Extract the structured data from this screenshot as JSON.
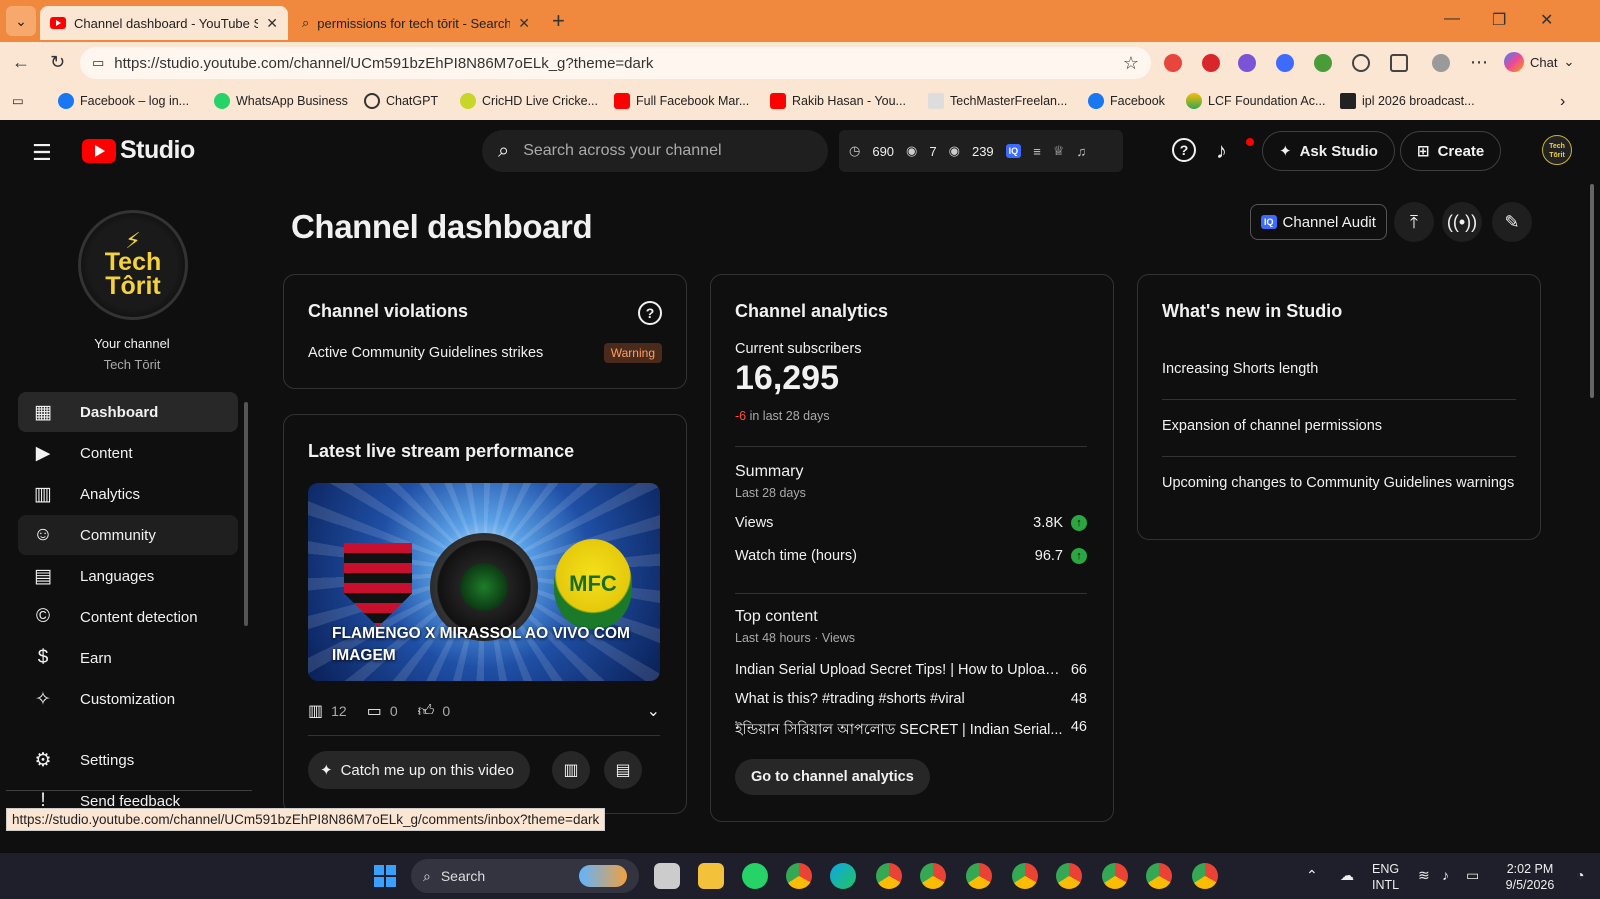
{
  "browser": {
    "tabs": [
      {
        "title": "Channel dashboard - YouTube Stu",
        "active": true
      },
      {
        "title": "permissions for tech tōrit - Search",
        "active": false
      }
    ],
    "url": "https://studio.youtube.com/channel/UCm591bzEhPI8N86M7oELk_g?theme=dark",
    "chat_label": "Chat",
    "bookmarks": [
      "Facebook – log in...",
      "WhatsApp Business",
      "ChatGPT",
      "CricHD Live Cricke...",
      "Full Facebook Mar...",
      "Rakib Hasan - You...",
      "TechMasterFreelan...",
      "Facebook",
      "LCF Foundation Ac...",
      "ipl 2026 broadcast..."
    ],
    "status_url": "https://studio.youtube.com/channel/UCm591bzEhPI8N86M7oELk_g/comments/inbox?theme=dark"
  },
  "header": {
    "logo_text": "Studio",
    "search_placeholder": "Search across your channel",
    "ext_stats": {
      "a": "690",
      "b": "7",
      "c": "239"
    },
    "ask_studio": "Ask Studio",
    "create": "Create",
    "avatar_text": "Tech Tōrit"
  },
  "sidebar": {
    "avatar_line1": "Tech",
    "avatar_line2": "Tôrit",
    "your_channel": "Your channel",
    "channel_name": "Tech Tōrit",
    "items": [
      {
        "label": "Dashboard",
        "icon": "dashboard-icon"
      },
      {
        "label": "Content",
        "icon": "content-icon"
      },
      {
        "label": "Analytics",
        "icon": "analytics-icon"
      },
      {
        "label": "Community",
        "icon": "community-icon"
      },
      {
        "label": "Languages",
        "icon": "subtitles-icon"
      },
      {
        "label": "Content detection",
        "icon": "copyright-icon"
      },
      {
        "label": "Earn",
        "icon": "dollar-icon"
      },
      {
        "label": "Customization",
        "icon": "magic-wand-icon"
      }
    ],
    "settings": "Settings",
    "feedback": "Send feedback"
  },
  "main": {
    "title": "Channel dashboard",
    "channel_audit": "Channel Audit",
    "violations": {
      "title": "Channel violations",
      "row": "Active Community Guidelines strikes",
      "badge": "Warning"
    },
    "live": {
      "title": "Latest live stream performance",
      "thumb_text": "FLAMENGO X MIRASSOL AO VIVO COM IMAGEM",
      "crest_text": "MFC",
      "views": "12",
      "comments": "0",
      "likes": "0",
      "catch_up": "Catch me up on this video"
    },
    "analytics": {
      "title": "Channel analytics",
      "subs_label": "Current subscribers",
      "subs_count": "16,295",
      "subs_delta": "-6",
      "subs_delta_suffix": "in last 28 days",
      "summary_title": "Summary",
      "summary_period": "Last 28 days",
      "metrics": [
        {
          "label": "Views",
          "value": "3.8K"
        },
        {
          "label": "Watch time (hours)",
          "value": "96.7"
        }
      ],
      "top_title": "Top content",
      "top_period": "Last 48 hours · Views",
      "top_items": [
        {
          "title": "Indian Serial Upload Secret Tips! | How to Upload...",
          "views": "66"
        },
        {
          "title": "What is this? #trading #shorts #viral",
          "views": "48"
        },
        {
          "title": "ইন্ডিয়ান সিরিয়াল আপলোড SECRET | Indian Serial...",
          "views": "46"
        }
      ],
      "go_button": "Go to channel analytics"
    },
    "whats_new": {
      "title": "What's new in Studio",
      "items": [
        "Increasing Shorts length",
        "Expansion of channel permissions",
        "Upcoming changes to Community Guidelines warnings"
      ]
    }
  },
  "taskbar": {
    "search": "Search",
    "lang1": "ENG",
    "lang2": "INTL",
    "time": "2:02 PM",
    "date": "9/5/2026"
  }
}
